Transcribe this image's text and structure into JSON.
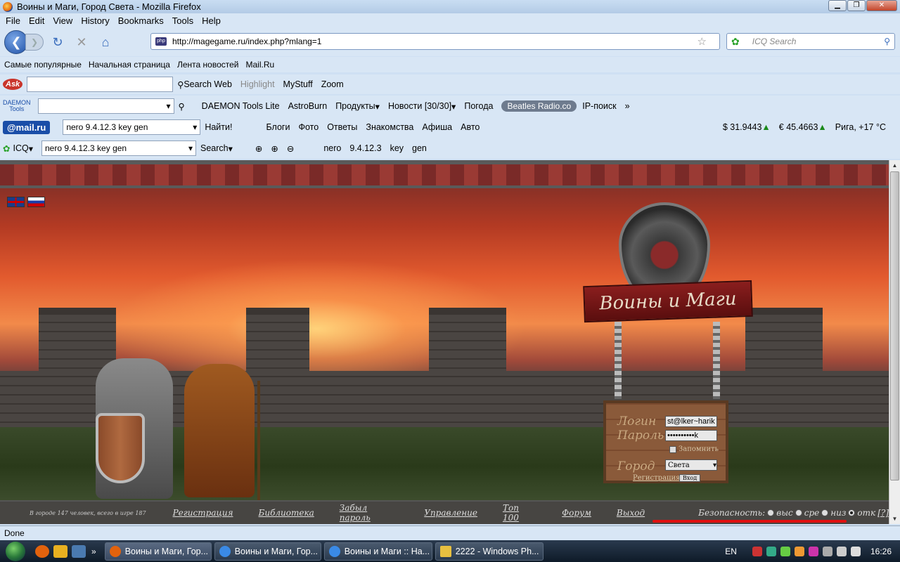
{
  "window": {
    "title": "Воины и Маги, Город Света - Mozilla Firefox"
  },
  "menu": [
    "File",
    "Edit",
    "View",
    "History",
    "Bookmarks",
    "Tools",
    "Help"
  ],
  "nav": {
    "url": "http://magegame.ru/index.php?mlang=1",
    "search_placeholder": "ICQ Search"
  },
  "bookmarks": [
    "Самые популярные",
    "Начальная страница",
    "Лента новостей",
    "Mail.Ru"
  ],
  "ask_toolbar": {
    "logo": "Ask",
    "search_web": "Search Web",
    "highlight": "Highlight",
    "mystuff": "MyStuff",
    "zoom": "Zoom"
  },
  "daemon_toolbar": {
    "logo_line1": "DAEMON",
    "logo_line2": "Tools",
    "daemon_lite": "DAEMON Tools Lite",
    "astroburn": "AstroBurn",
    "products": "Продукты",
    "news": "Новости [30/30]",
    "weather": "Погода",
    "radio": "Beatles Radio.co",
    "ipsearch": "IP-поиск"
  },
  "mail_toolbar": {
    "logo": "@mail.ru",
    "query": "nero 9.4.12.3 key gen",
    "find": "Найти!",
    "blogs": "Блоги",
    "photo": "Фото",
    "answers": "Ответы",
    "dating": "Знакомства",
    "poster": "Афиша",
    "auto": "Авто",
    "usd": "$ 31.9443",
    "eur": "€ 45.4663",
    "weather": "Рига, +17 °C"
  },
  "icq_toolbar": {
    "logo": "ICQ",
    "query": "nero 9.4.12.3 key gen",
    "search": "Search",
    "w1": "nero",
    "w2": "9.4.12.3",
    "w3": "key",
    "w4": "gen"
  },
  "game": {
    "logo": "Воины и Маги",
    "login_label": "Логин",
    "password_label": "Пароль",
    "login_value": "st@lker~harik",
    "password_value": "••••••••••k",
    "remember": "Запомнить",
    "city_label": "Город",
    "city_value": "Света",
    "register_link": "Регистрация",
    "enter_button": "Вход",
    "online": "В городе 147 человек, всего в игре 187",
    "links": [
      "Регистрация",
      "Библиотека",
      "Забыл пароль",
      "Управление",
      "Топ 100",
      "Форум",
      "Выход"
    ],
    "security_label": "Безопасность:",
    "security_options": [
      "выс",
      "сре",
      "низ",
      "отк"
    ],
    "security_selected": "отк",
    "help": "[?]"
  },
  "status": "Done",
  "taskbar": {
    "tasks": [
      "Воины и Маги, Гор...",
      "Воины и Маги, Гор...",
      "Воины и Маги :: На...",
      "2222 - Windows Ph..."
    ],
    "lang": "EN",
    "time": "16:26"
  }
}
